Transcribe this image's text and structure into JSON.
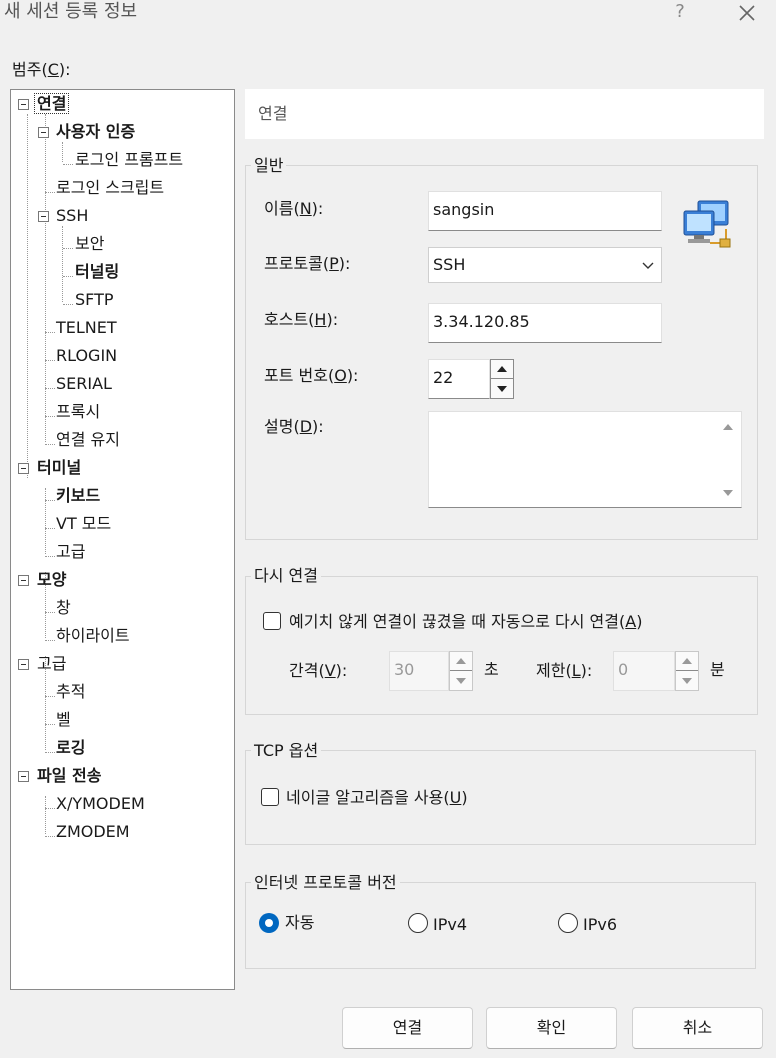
{
  "window": {
    "title": "새 세션 등록 정보",
    "help": "?"
  },
  "category": {
    "label": "범주",
    "accel": "C"
  },
  "tree": [
    {
      "label": "연결",
      "bold": true,
      "selected": true
    },
    {
      "label": "사용자 인증",
      "bold": true
    },
    {
      "label": "로그인 프롬프트"
    },
    {
      "label": "로그인 스크립트"
    },
    {
      "label": "SSH"
    },
    {
      "label": "보안"
    },
    {
      "label": "터널링",
      "bold": true
    },
    {
      "label": "SFTP"
    },
    {
      "label": "TELNET"
    },
    {
      "label": "RLOGIN"
    },
    {
      "label": "SERIAL"
    },
    {
      "label": "프록시"
    },
    {
      "label": "연결 유지"
    },
    {
      "label": "터미널",
      "bold": true
    },
    {
      "label": "키보드",
      "bold": true
    },
    {
      "label": "VT 모드"
    },
    {
      "label": "고급"
    },
    {
      "label": "모양",
      "bold": true
    },
    {
      "label": "창"
    },
    {
      "label": "하이라이트"
    },
    {
      "label": "고급"
    },
    {
      "label": "추적"
    },
    {
      "label": "벨"
    },
    {
      "label": "로깅",
      "bold": true
    },
    {
      "label": "파일 전송",
      "bold": true
    },
    {
      "label": "X/YMODEM"
    },
    {
      "label": "ZMODEM"
    }
  ],
  "header": {
    "title": "연결"
  },
  "general": {
    "title": "일반",
    "name_label": "이름",
    "name_accel": "N",
    "name_value": "sangsin",
    "protocol_label": "프로토콜",
    "protocol_accel": "P",
    "protocol_value": "SSH",
    "host_label": "호스트",
    "host_accel": "H",
    "host_value": "3.34.120.85",
    "port_label": "포트 번호",
    "port_accel": "O",
    "port_value": "22",
    "desc_label": "설명",
    "desc_accel": "D",
    "desc_value": ""
  },
  "reconnect": {
    "title": "다시 연결",
    "auto_label": "예기치 않게 연결이 끊겼을 때 자동으로 다시 연결",
    "auto_accel": "A",
    "auto_checked": false,
    "interval_label": "간격",
    "interval_accel": "V",
    "interval_value": "30",
    "interval_unit": "초",
    "limit_label": "제한",
    "limit_accel": "L",
    "limit_value": "0",
    "limit_unit": "분"
  },
  "tcp": {
    "title": "TCP 옵션",
    "nagle_label": "네이글 알고리즘을 사용",
    "nagle_accel": "U",
    "nagle_checked": false
  },
  "ipver": {
    "title": "인터넷 프로토콜 버전",
    "options": [
      "자동",
      "IPv4",
      "IPv6"
    ],
    "selected": "자동"
  },
  "buttons": {
    "connect": "연결",
    "ok": "확인",
    "cancel": "취소"
  },
  "colors": {
    "accent": "#0067c0",
    "background": "#f0f0f0"
  }
}
